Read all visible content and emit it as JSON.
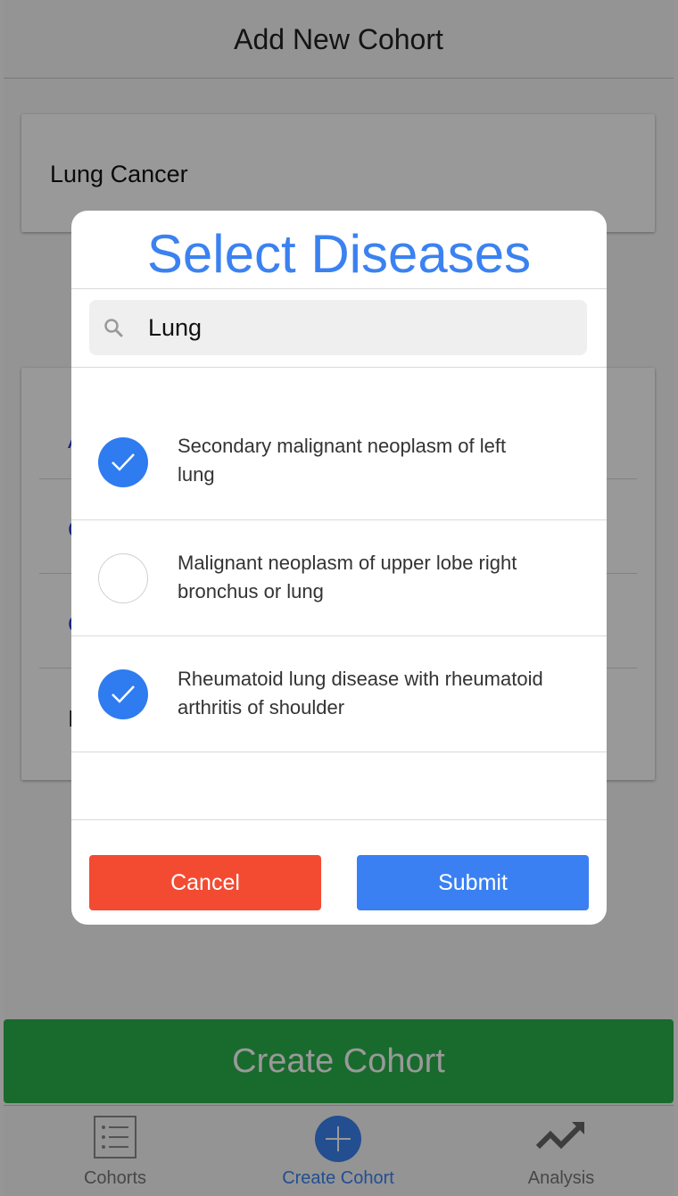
{
  "header": {
    "title": "Add New Cohort"
  },
  "cohort_name": {
    "value": "Lung Cancer"
  },
  "create_button": {
    "label": "Create Cohort"
  },
  "tabs": [
    {
      "label": "Cohorts",
      "icon": "list-icon",
      "active": false
    },
    {
      "label": "Create Cohort",
      "icon": "plus-circle-icon",
      "active": true
    },
    {
      "label": "Analysis",
      "icon": "trend-icon",
      "active": false
    }
  ],
  "dialog": {
    "title": "Select Diseases",
    "search": {
      "value": "Lung",
      "icon": "search-icon"
    },
    "items": [
      {
        "label_line1": "Secondary malignant neoplasm of left",
        "label_line2": "lung",
        "checked": true
      },
      {
        "label_line1": "Malignant neoplasm of upper lobe right",
        "label_line2": "bronchus or lung",
        "checked": false
      },
      {
        "label_line1": "Rheumatoid lung disease with rheumatoid",
        "label_line2": "arthritis of shoulder",
        "checked": true
      }
    ],
    "cancel_label": "Cancel",
    "submit_label": "Submit"
  },
  "colors": {
    "accent_blue": "#3b82f0",
    "cancel_red": "#f34b32",
    "create_green": "#2bb14c"
  }
}
